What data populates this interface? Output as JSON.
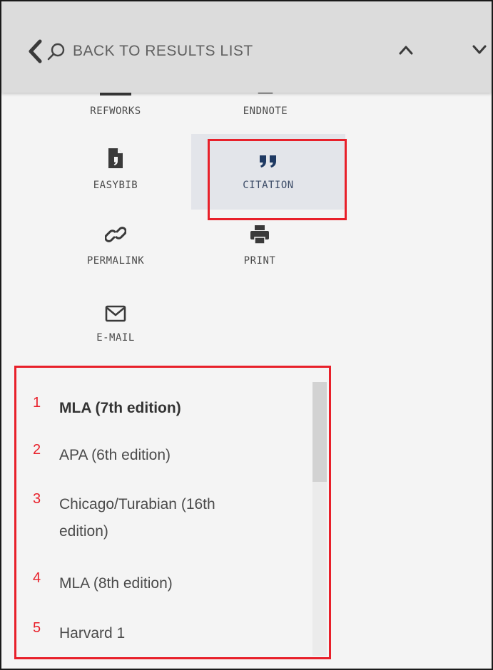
{
  "header": {
    "back_label": "BACK TO RESULTS LIST"
  },
  "actions": [
    {
      "id": "refworks",
      "label": "REFWORKS",
      "icon": "refworks-icon"
    },
    {
      "id": "endnote",
      "label": "ENDNOTE",
      "icon": "endnote-icon"
    },
    {
      "id": "easybib",
      "label": "EASYBIB",
      "icon": "document-icon"
    },
    {
      "id": "citation",
      "label": "CITATION",
      "icon": "quote-icon",
      "selected": true
    },
    {
      "id": "permalink",
      "label": "PERMALINK",
      "icon": "link-icon"
    },
    {
      "id": "print",
      "label": "PRINT",
      "icon": "printer-icon"
    },
    {
      "id": "email",
      "label": "E-MAIL",
      "icon": "envelope-icon"
    }
  ],
  "citation_styles": [
    {
      "num": "1",
      "label": "MLA (7th edition)",
      "selected": true
    },
    {
      "num": "2",
      "label": "APA (6th edition)"
    },
    {
      "num": "3",
      "label": "Chicago/Turabian (16th edition)"
    },
    {
      "num": "4",
      "label": "MLA (8th edition)"
    },
    {
      "num": "5",
      "label": "Harvard 1"
    }
  ],
  "colors": {
    "accent_red": "#e8202a",
    "icon_dark": "#3a3a3a",
    "quote_navy": "#1f3a63",
    "selected_bg": "#e3e5ea"
  }
}
